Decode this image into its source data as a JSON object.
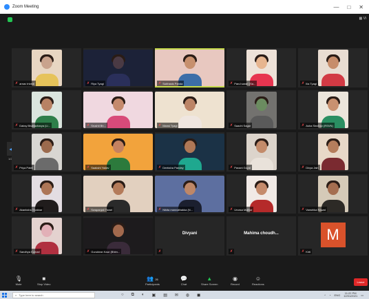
{
  "window": {
    "title": "Zoom Meeting"
  },
  "view_button": "Vi",
  "tiles": [
    {
      "name": "arnav trivedi",
      "colors": [
        "#e8d6c2",
        "#c9a38d",
        "#e6c35a"
      ]
    },
    {
      "name": "Riya Tyagi",
      "colors": [
        "#1c2238",
        "#4a3a44",
        "#2a2f5a"
      ]
    },
    {
      "name": "Subhasis Panda",
      "colors": [
        "#e8c8c0",
        "#c7906e",
        "#3d6ea8"
      ],
      "active": true
    },
    {
      "name": "Parul saran (Sa...",
      "colors": [
        "#eee2d8",
        "#e7b58f",
        "#e73550"
      ]
    },
    {
      "name": "Ilia Tyagi",
      "colors": [
        "#e9ddd2",
        "#c78d6b",
        "#d23a44"
      ]
    },
    {
      "name": "Daksy Bhattacharya (Li...",
      "colors": [
        "#dbe5de",
        "#b88264",
        "#2e7f4a"
      ]
    },
    {
      "name": "Srushti Bh...",
      "colors": [
        "#f0d8e0",
        "#c58a6d",
        "#d84a7a"
      ]
    },
    {
      "name": "Mansi Tyagi",
      "colors": [
        "#eee2d0",
        "#bc8466",
        "#efe6e0"
      ]
    },
    {
      "name": "Saachi Sagar",
      "colors": [
        "#73726f",
        "#6b8c60",
        "#5a5a5a"
      ]
    },
    {
      "name": "Asha Sindhav (RSVN)",
      "colors": [
        "#ece6dc",
        "#c99170",
        "#2a8f62"
      ]
    },
    {
      "name": "Priya Patel",
      "colors": [
        "#d8d6d2",
        "#9b6a4d",
        "#6b6b6b"
      ]
    },
    {
      "name": "Saakshi Yadav",
      "colors": [
        "#f2a33c",
        "#c58260",
        "#2c7a3c"
      ]
    },
    {
      "name": "Deeksha Pandey",
      "colors": [
        "#1b3246",
        "#b07856",
        "#1fa88f"
      ]
    },
    {
      "name": "Pavani Goyal",
      "colors": [
        "#dcd4cb",
        "#c38b6a",
        "#e9e2da"
      ]
    },
    {
      "name": "Divya Jain",
      "colors": [
        "#e8d8c8",
        "#b57d5c",
        "#7a2a30"
      ]
    },
    {
      "name": "Akanksha Thakkar",
      "colors": [
        "#e3dde2",
        "#ad7657",
        "#201c1c"
      ]
    },
    {
      "name": "Swapanjali Tiwari",
      "colors": [
        "#e2d0bf",
        "#b47b5a",
        "#2a2a2a"
      ]
    },
    {
      "name": "Nikita mannathakka (N...",
      "colors": [
        "#5d6fa0",
        "#be8767",
        "#1b1f2f"
      ]
    },
    {
      "name": "Urvasa Mathur",
      "colors": [
        "#f1eae6",
        "#c58b6c",
        "#b52a2a"
      ]
    },
    {
      "name": "Vanshika Rawat",
      "colors": [
        "#d5cab8",
        "#a56e50",
        "#2d2a26"
      ]
    },
    {
      "name": "Sandhya Kumari",
      "colors": [
        "#e4d2cf",
        "#e2b0b7",
        "#b03040"
      ]
    },
    {
      "name": "Gurukiran Kaur (Bhim...",
      "colors": [
        "#1d1b1d",
        "#a2694d",
        "#3a2b3a"
      ]
    },
    {
      "name": "",
      "center_label": "Divyani"
    },
    {
      "name": "",
      "center_label": "Mahima choudh..."
    },
    {
      "name": "Kirti",
      "avatar_letter": "M",
      "avatar_color": "#d9522b"
    }
  ],
  "page_left": "1/2",
  "page_right": "2/2",
  "toolbar": {
    "mute": "Mute",
    "stop_video": "Stop Video",
    "participants_count": "26",
    "participants": "Participants",
    "chat": "Chat",
    "share_screen": "Share Screen",
    "record": "Record",
    "reactions": "Reactions",
    "end": "Leave"
  },
  "taskbar": {
    "search_placeholder": "Type here to search",
    "lang": "ENG",
    "time": "11:22 PM",
    "date": "12/01/2021"
  }
}
